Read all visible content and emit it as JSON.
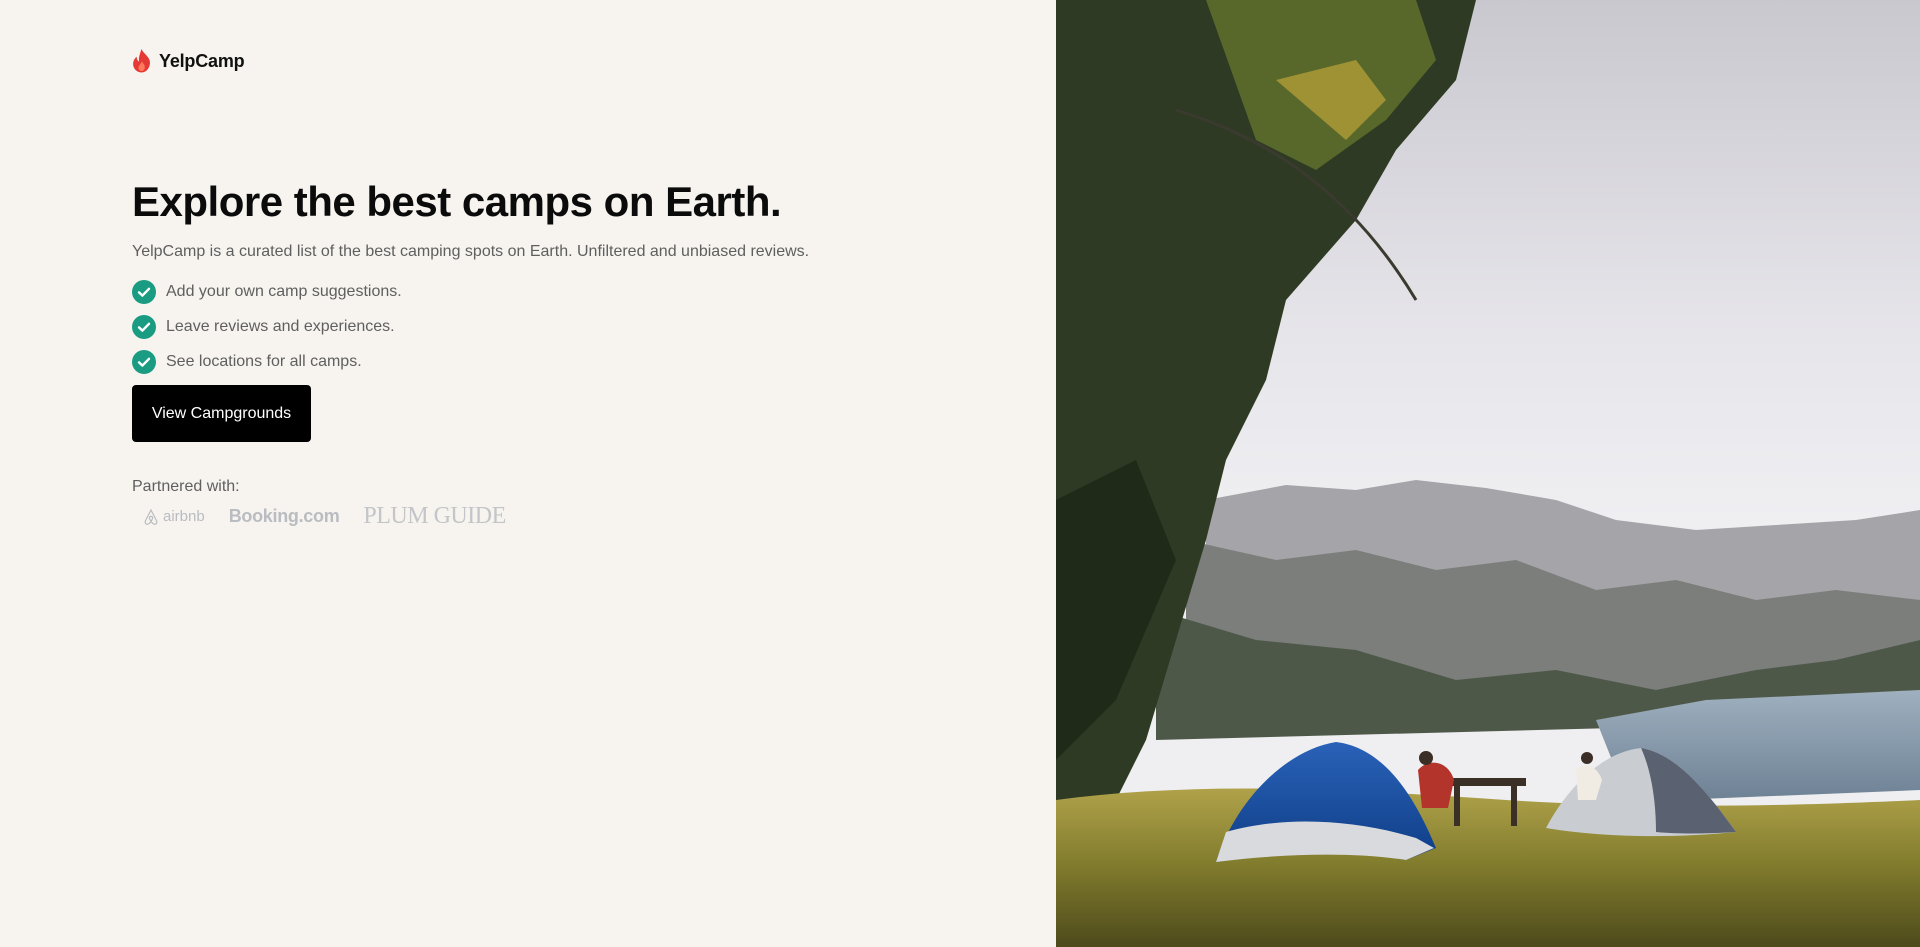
{
  "brand": {
    "name": "YelpCamp",
    "logo_icon": "flame-icon",
    "accent_color": "#e53935"
  },
  "hero": {
    "headline": "Explore the best camps on Earth.",
    "subtext": "YelpCamp is a curated list of the best camping spots on Earth. Unfiltered and unbiased reviews.",
    "features": [
      {
        "icon": "check-circle-icon",
        "label": "Add your own camp suggestions."
      },
      {
        "icon": "check-circle-icon",
        "label": "Leave reviews and experiences."
      },
      {
        "icon": "check-circle-icon",
        "label": "See locations for all camps."
      }
    ],
    "check_color": "#1a9c82",
    "cta_label": "View Campgrounds"
  },
  "partners": {
    "label": "Partnered with:",
    "logos": [
      "airbnb",
      "Booking.com",
      "PLUM GUIDE"
    ]
  },
  "hero_image": {
    "subject": "camping-tents-lake-view-photo"
  }
}
